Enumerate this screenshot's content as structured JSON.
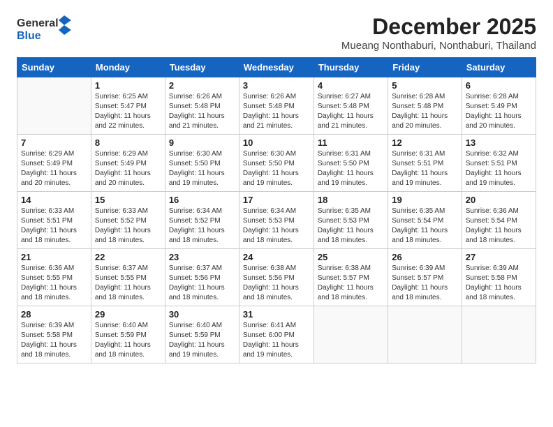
{
  "header": {
    "logo_general": "General",
    "logo_blue": "Blue",
    "title": "December 2025",
    "subtitle": "Mueang Nonthaburi, Nonthaburi, Thailand"
  },
  "days_of_week": [
    "Sunday",
    "Monday",
    "Tuesday",
    "Wednesday",
    "Thursday",
    "Friday",
    "Saturday"
  ],
  "weeks": [
    [
      {
        "day": "",
        "info": ""
      },
      {
        "day": "1",
        "info": "Sunrise: 6:25 AM\nSunset: 5:47 PM\nDaylight: 11 hours\nand 22 minutes."
      },
      {
        "day": "2",
        "info": "Sunrise: 6:26 AM\nSunset: 5:48 PM\nDaylight: 11 hours\nand 21 minutes."
      },
      {
        "day": "3",
        "info": "Sunrise: 6:26 AM\nSunset: 5:48 PM\nDaylight: 11 hours\nand 21 minutes."
      },
      {
        "day": "4",
        "info": "Sunrise: 6:27 AM\nSunset: 5:48 PM\nDaylight: 11 hours\nand 21 minutes."
      },
      {
        "day": "5",
        "info": "Sunrise: 6:28 AM\nSunset: 5:48 PM\nDaylight: 11 hours\nand 20 minutes."
      },
      {
        "day": "6",
        "info": "Sunrise: 6:28 AM\nSunset: 5:49 PM\nDaylight: 11 hours\nand 20 minutes."
      }
    ],
    [
      {
        "day": "7",
        "info": "Sunrise: 6:29 AM\nSunset: 5:49 PM\nDaylight: 11 hours\nand 20 minutes."
      },
      {
        "day": "8",
        "info": "Sunrise: 6:29 AM\nSunset: 5:49 PM\nDaylight: 11 hours\nand 20 minutes."
      },
      {
        "day": "9",
        "info": "Sunrise: 6:30 AM\nSunset: 5:50 PM\nDaylight: 11 hours\nand 19 minutes."
      },
      {
        "day": "10",
        "info": "Sunrise: 6:30 AM\nSunset: 5:50 PM\nDaylight: 11 hours\nand 19 minutes."
      },
      {
        "day": "11",
        "info": "Sunrise: 6:31 AM\nSunset: 5:50 PM\nDaylight: 11 hours\nand 19 minutes."
      },
      {
        "day": "12",
        "info": "Sunrise: 6:31 AM\nSunset: 5:51 PM\nDaylight: 11 hours\nand 19 minutes."
      },
      {
        "day": "13",
        "info": "Sunrise: 6:32 AM\nSunset: 5:51 PM\nDaylight: 11 hours\nand 19 minutes."
      }
    ],
    [
      {
        "day": "14",
        "info": "Sunrise: 6:33 AM\nSunset: 5:51 PM\nDaylight: 11 hours\nand 18 minutes."
      },
      {
        "day": "15",
        "info": "Sunrise: 6:33 AM\nSunset: 5:52 PM\nDaylight: 11 hours\nand 18 minutes."
      },
      {
        "day": "16",
        "info": "Sunrise: 6:34 AM\nSunset: 5:52 PM\nDaylight: 11 hours\nand 18 minutes."
      },
      {
        "day": "17",
        "info": "Sunrise: 6:34 AM\nSunset: 5:53 PM\nDaylight: 11 hours\nand 18 minutes."
      },
      {
        "day": "18",
        "info": "Sunrise: 6:35 AM\nSunset: 5:53 PM\nDaylight: 11 hours\nand 18 minutes."
      },
      {
        "day": "19",
        "info": "Sunrise: 6:35 AM\nSunset: 5:54 PM\nDaylight: 11 hours\nand 18 minutes."
      },
      {
        "day": "20",
        "info": "Sunrise: 6:36 AM\nSunset: 5:54 PM\nDaylight: 11 hours\nand 18 minutes."
      }
    ],
    [
      {
        "day": "21",
        "info": "Sunrise: 6:36 AM\nSunset: 5:55 PM\nDaylight: 11 hours\nand 18 minutes."
      },
      {
        "day": "22",
        "info": "Sunrise: 6:37 AM\nSunset: 5:55 PM\nDaylight: 11 hours\nand 18 minutes."
      },
      {
        "day": "23",
        "info": "Sunrise: 6:37 AM\nSunset: 5:56 PM\nDaylight: 11 hours\nand 18 minutes."
      },
      {
        "day": "24",
        "info": "Sunrise: 6:38 AM\nSunset: 5:56 PM\nDaylight: 11 hours\nand 18 minutes."
      },
      {
        "day": "25",
        "info": "Sunrise: 6:38 AM\nSunset: 5:57 PM\nDaylight: 11 hours\nand 18 minutes."
      },
      {
        "day": "26",
        "info": "Sunrise: 6:39 AM\nSunset: 5:57 PM\nDaylight: 11 hours\nand 18 minutes."
      },
      {
        "day": "27",
        "info": "Sunrise: 6:39 AM\nSunset: 5:58 PM\nDaylight: 11 hours\nand 18 minutes."
      }
    ],
    [
      {
        "day": "28",
        "info": "Sunrise: 6:39 AM\nSunset: 5:58 PM\nDaylight: 11 hours\nand 18 minutes."
      },
      {
        "day": "29",
        "info": "Sunrise: 6:40 AM\nSunset: 5:59 PM\nDaylight: 11 hours\nand 18 minutes."
      },
      {
        "day": "30",
        "info": "Sunrise: 6:40 AM\nSunset: 5:59 PM\nDaylight: 11 hours\nand 19 minutes."
      },
      {
        "day": "31",
        "info": "Sunrise: 6:41 AM\nSunset: 6:00 PM\nDaylight: 11 hours\nand 19 minutes."
      },
      {
        "day": "",
        "info": ""
      },
      {
        "day": "",
        "info": ""
      },
      {
        "day": "",
        "info": ""
      }
    ]
  ]
}
